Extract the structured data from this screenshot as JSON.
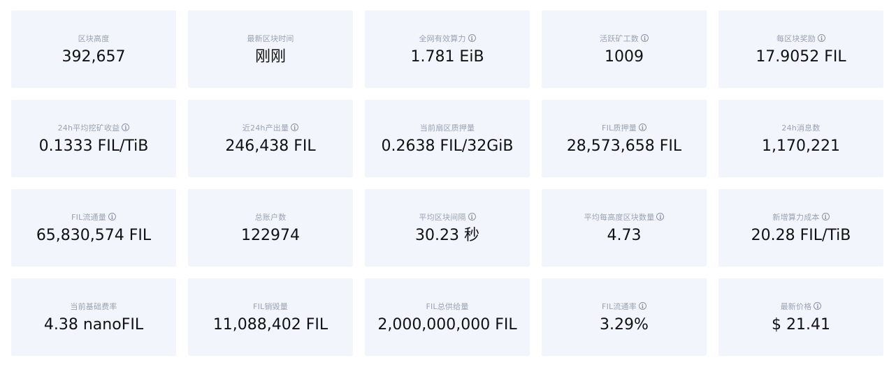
{
  "stats": [
    {
      "label": "区块高度",
      "value": "392,657",
      "info": false
    },
    {
      "label": "最新区块时间",
      "value": "刚刚",
      "info": false
    },
    {
      "label": "全网有效算力",
      "value": "1.781 EiB",
      "info": true
    },
    {
      "label": "活跃矿工数",
      "value": "1009",
      "info": true
    },
    {
      "label": "每区块奖励",
      "value": "17.9052 FIL",
      "info": true
    },
    {
      "label": "24h平均挖矿收益",
      "value": "0.1333 FIL/TiB",
      "info": true
    },
    {
      "label": "近24h产出量",
      "value": "246,438 FIL",
      "info": true
    },
    {
      "label": "当前扇区质押量",
      "value": "0.2638 FIL/32GiB",
      "info": false
    },
    {
      "label": "FIL质押量",
      "value": "28,573,658 FIL",
      "info": true
    },
    {
      "label": "24h消息数",
      "value": "1,170,221",
      "info": false
    },
    {
      "label": "FIL流通量",
      "value": "65,830,574 FIL",
      "info": true
    },
    {
      "label": "总账户数",
      "value": "122974",
      "info": false
    },
    {
      "label": "平均区块间隔",
      "value": "30.23 秒",
      "info": true
    },
    {
      "label": "平均每高度区块数量",
      "value": "4.73",
      "info": true
    },
    {
      "label": "新增算力成本",
      "value": "20.28 FIL/TiB",
      "info": true
    },
    {
      "label": "当前基础费率",
      "value": "4.38 nanoFIL",
      "info": false
    },
    {
      "label": "FIL销毁量",
      "value": "11,088,402 FIL",
      "info": false
    },
    {
      "label": "FIL总供给量",
      "value": "2,000,000,000 FIL",
      "info": false
    },
    {
      "label": "FIL流通率",
      "value": "3.29%",
      "info": true
    },
    {
      "label": "最新价格",
      "value": "$ 21.41",
      "info": true
    }
  ],
  "info_icon_glyph": "i"
}
